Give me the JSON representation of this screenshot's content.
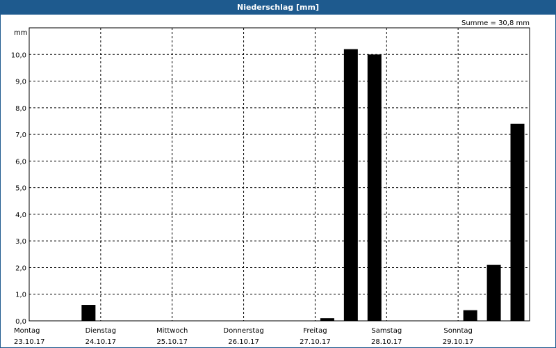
{
  "window": {
    "title": "Niederschlag [mm]"
  },
  "chart_data": {
    "type": "bar",
    "title": "Niederschlag [mm]",
    "ylabel": "mm",
    "annotation": "Summe = 30,8 mm",
    "ylim": [
      0,
      11
    ],
    "yticks": [
      "0,0",
      "1,0",
      "2,0",
      "3,0",
      "4,0",
      "5,0",
      "6,0",
      "7,0",
      "8,0",
      "9,0",
      "10,0"
    ],
    "xrange": [
      0,
      7
    ],
    "days": [
      {
        "name": "Montag",
        "date": "23.10.17"
      },
      {
        "name": "Dienstag",
        "date": "24.10.17"
      },
      {
        "name": "Mittwoch",
        "date": "25.10.17"
      },
      {
        "name": "Donnerstag",
        "date": "26.10.17"
      },
      {
        "name": "Freitag",
        "date": "27.10.17"
      },
      {
        "name": "Samstag",
        "date": "28.10.17"
      },
      {
        "name": "Sonntag",
        "date": "29.10.17"
      }
    ],
    "bars": [
      {
        "day": 0.83,
        "value": 0.6
      },
      {
        "day": 4.17,
        "value": 0.1
      },
      {
        "day": 4.5,
        "value": 10.2
      },
      {
        "day": 4.83,
        "value": 10.0
      },
      {
        "day": 6.17,
        "value": 0.4
      },
      {
        "day": 6.5,
        "value": 2.1
      },
      {
        "day": 6.83,
        "value": 7.4
      }
    ],
    "grid": true,
    "colors": {
      "bar": "#000000",
      "header": "#1e5a8e",
      "grid": "#000000"
    }
  }
}
